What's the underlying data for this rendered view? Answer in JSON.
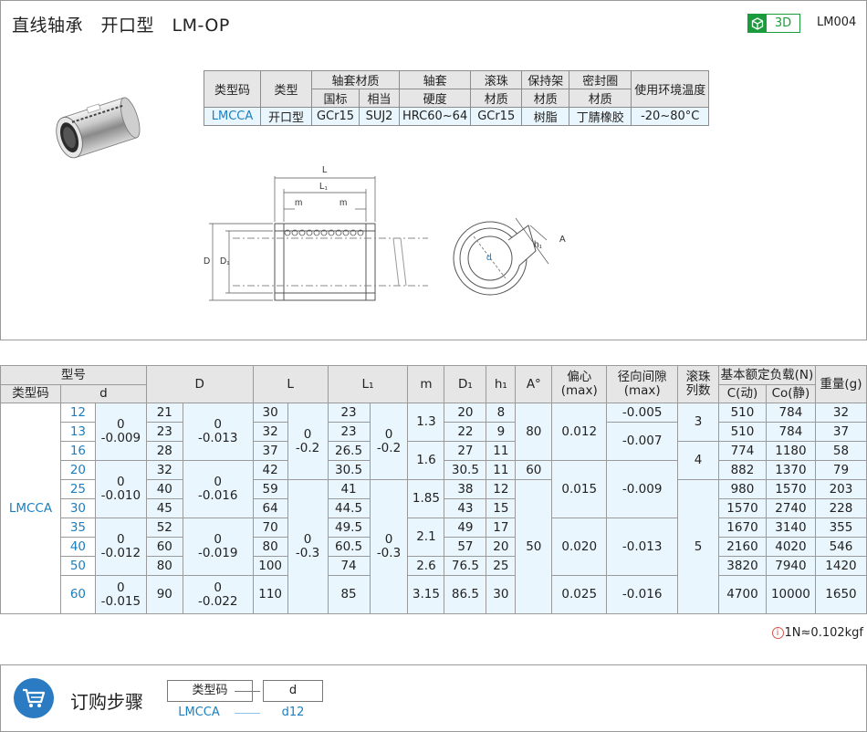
{
  "header": {
    "title": "直线轴承　开口型　LM-OP",
    "badge_3d": "3D",
    "code": "LM004"
  },
  "spec_table": {
    "col1": "类型码",
    "col2": "类型",
    "sleeve_material": "轴套材质",
    "sleeve_gb": "国标",
    "sleeve_eq": "相当",
    "sleeve": "轴套",
    "hardness": "硬度",
    "ball": "滚珠",
    "ball_mat": "材质",
    "cage": "保持架",
    "cage_mat": "材质",
    "seal": "密封圈",
    "seal_mat": "材质",
    "env": "使用环境温度",
    "v_code": "LMCCA",
    "v_type": "开口型",
    "v_gb": "GCr15",
    "v_eq": "SUJ2",
    "v_hard": "HRC60~64",
    "v_ball": "GCr15",
    "v_cage": "树脂",
    "v_seal": "丁腈橡胶",
    "v_env": "-20~80°C"
  },
  "drawing": {
    "L": "L",
    "L1": "L₁",
    "m1": "m",
    "m2": "m",
    "D": "D",
    "D1": "D₁",
    "d": "d",
    "h1": "h₁",
    "A": "A"
  },
  "data_table": {
    "h_model": "型号",
    "h_code": "类型码",
    "h_d": "d",
    "h_D": "D",
    "h_L": "L",
    "h_L1": "L₁",
    "h_m": "m",
    "h_D1": "D₁",
    "h_h1": "h₁",
    "h_A": "A°",
    "h_ecc": "偏心\n(max)",
    "h_ecc1": "偏心",
    "h_ecc2": "(max)",
    "h_rad1": "径向间隙",
    "h_rad2": "(max)",
    "h_rows1": "滚珠",
    "h_rows2": "列数",
    "h_load": "基本额定负载(N)",
    "h_C": "C(动)",
    "h_Co": "Co(静)",
    "h_wt": "重量(g)",
    "type_code": "LMCCA",
    "d": [
      "12",
      "13",
      "16",
      "20",
      "25",
      "30",
      "35",
      "40",
      "50",
      "60"
    ],
    "dtol": [
      [
        "0",
        "-0.009"
      ],
      [
        "0",
        "-0.010"
      ],
      [
        "0",
        "-0.012"
      ],
      [
        "0",
        "-0.015"
      ]
    ],
    "D": [
      "21",
      "23",
      "28",
      "32",
      "40",
      "45",
      "52",
      "60",
      "80",
      "90"
    ],
    "Dtol": [
      [
        "0",
        "-0.013"
      ],
      [
        "0",
        "-0.016"
      ],
      [
        "0",
        "-0.019"
      ],
      [
        "0",
        "-0.022"
      ]
    ],
    "L": [
      "30",
      "32",
      "37",
      "42",
      "59",
      "64",
      "70",
      "80",
      "100",
      "110"
    ],
    "Ltol": [
      [
        "0",
        "-0.2"
      ],
      [
        "0",
        "-0.3"
      ]
    ],
    "L1": [
      "23",
      "23",
      "26.5",
      "30.5",
      "41",
      "44.5",
      "49.5",
      "60.5",
      "74",
      "85"
    ],
    "L1tol": [
      [
        "0",
        "-0.2"
      ],
      [
        "0",
        "-0.3"
      ]
    ],
    "m": [
      "1.3",
      "1.6",
      "1.85",
      "2.1",
      "2.6",
      "3.15"
    ],
    "D1": [
      "20",
      "22",
      "27",
      "30.5",
      "38",
      "43",
      "49",
      "57",
      "76.5",
      "86.5"
    ],
    "h1": [
      "8",
      "9",
      "11",
      "11",
      "12",
      "15",
      "17",
      "20",
      "25",
      "30"
    ],
    "A": [
      "80",
      "60",
      "50"
    ],
    "ecc": [
      "0.012",
      "0.015",
      "0.020",
      "0.025"
    ],
    "rad": [
      "-0.005",
      "-0.007",
      "-0.009",
      "-0.013",
      "-0.016"
    ],
    "rows": [
      "3",
      "4",
      "5"
    ],
    "C": [
      "510",
      "510",
      "774",
      "882",
      "980",
      "1570",
      "1670",
      "2160",
      "3820",
      "4700"
    ],
    "Co": [
      "784",
      "784",
      "1180",
      "1370",
      "1570",
      "2740",
      "3140",
      "4020",
      "7940",
      "10000"
    ],
    "wt": [
      "32",
      "37",
      "58",
      "79",
      "203",
      "228",
      "355",
      "546",
      "1420",
      "1650"
    ]
  },
  "note": "1N≈0.102kgf",
  "order": {
    "title": "订购步骤",
    "box1": "类型码",
    "box2": "d",
    "val1": "LMCCA",
    "val2": "d12"
  },
  "colors": {
    "accent": "#1a7fc0",
    "green": "#1b9c3c",
    "header_bg": "#e6e6e6",
    "value_bg": "#eaf6fd"
  }
}
